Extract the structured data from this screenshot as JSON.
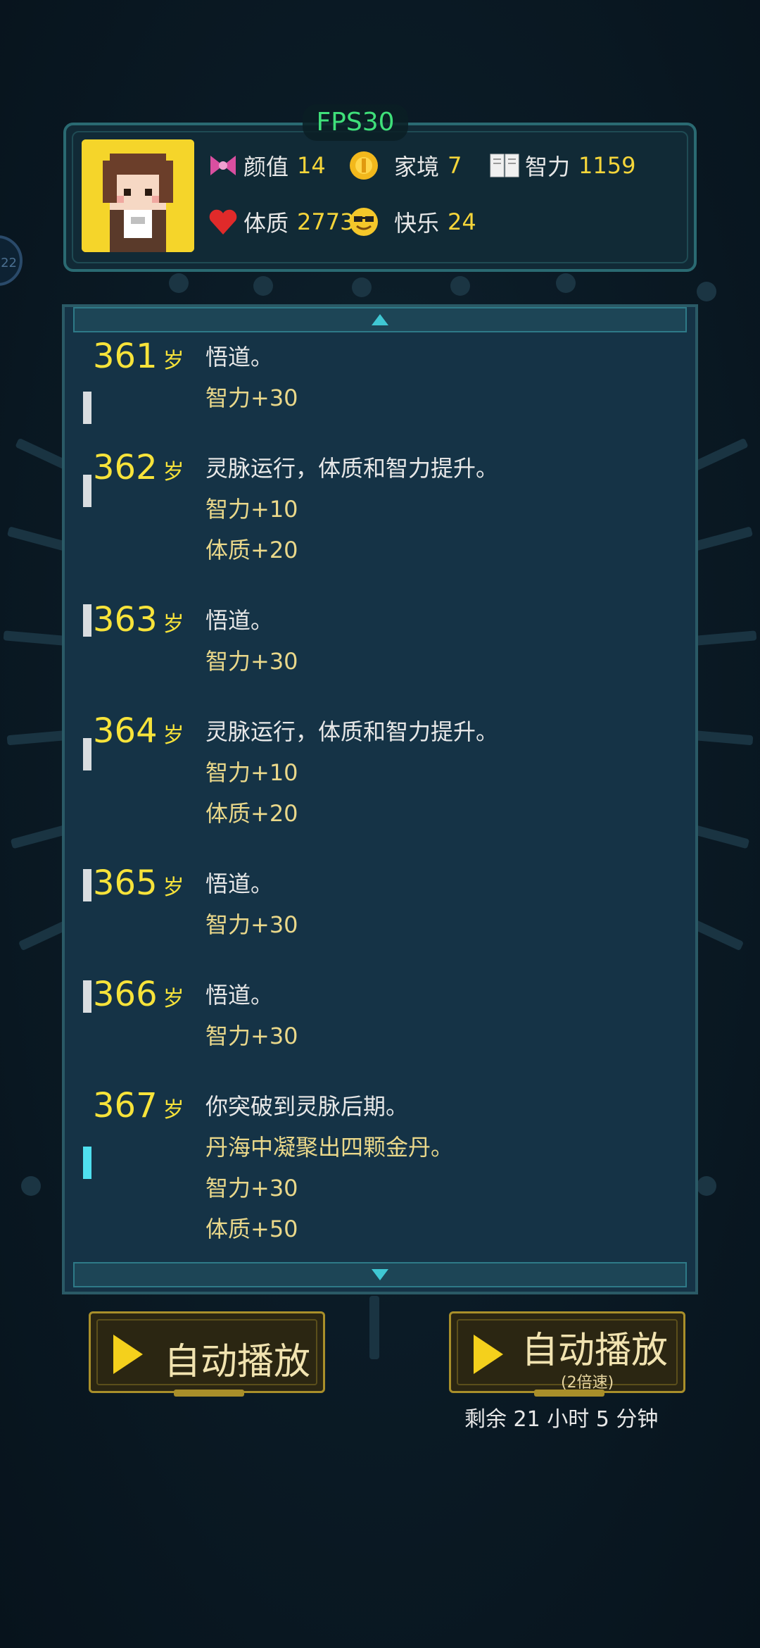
{
  "hud": {
    "fps": "FPS30",
    "edge_badge": "22"
  },
  "stats": [
    {
      "icon": "bow-icon",
      "label": "颜值",
      "value": "14"
    },
    {
      "icon": "coin-icon",
      "label": "家境",
      "value": "7"
    },
    {
      "icon": "book-icon",
      "label": "智力",
      "value": "1159"
    },
    {
      "icon": "heart-icon",
      "label": "体质",
      "value": "2773"
    },
    {
      "icon": "sunglasses-smile-icon",
      "label": "快乐",
      "value": "24"
    }
  ],
  "log": [
    {
      "age": "361",
      "unit": "岁",
      "lines": [
        "悟道。",
        "智力+30"
      ]
    },
    {
      "age": "362",
      "unit": "岁",
      "lines": [
        "灵脉运行，体质和智力提升。",
        "智力+10",
        "体质+20"
      ]
    },
    {
      "age": "363",
      "unit": "岁",
      "lines": [
        "悟道。",
        "智力+30"
      ]
    },
    {
      "age": "364",
      "unit": "岁",
      "lines": [
        "灵脉运行，体质和智力提升。",
        "智力+10",
        "体质+20"
      ]
    },
    {
      "age": "365",
      "unit": "岁",
      "lines": [
        "悟道。",
        "智力+30"
      ]
    },
    {
      "age": "366",
      "unit": "岁",
      "lines": [
        "悟道。",
        "智力+30"
      ]
    },
    {
      "age": "367",
      "unit": "岁",
      "lines": [
        "你突破到灵脉后期。",
        "丹海中凝聚出四颗金丹。",
        "智力+30",
        "体质+50"
      ]
    }
  ],
  "buttons": {
    "auto_play": "自动播放",
    "auto_play_2x": "自动播放",
    "auto_play_2x_sub": "(2倍速)"
  },
  "remaining": "剩余 21 小时 5 分钟"
}
